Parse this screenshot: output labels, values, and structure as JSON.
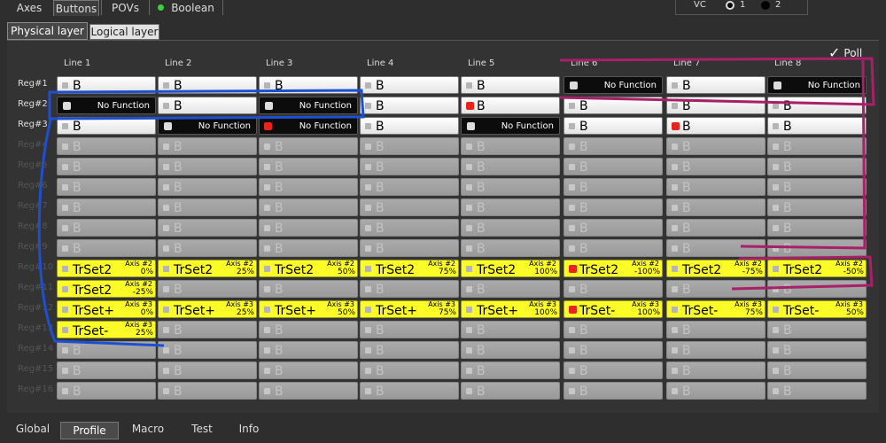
{
  "top_tabs": [
    {
      "label": "Axes",
      "active": false
    },
    {
      "label": "Buttons",
      "active": true
    },
    {
      "label": "POVs",
      "active": false
    },
    {
      "label": "Boolean",
      "active": false
    }
  ],
  "vc": {
    "label": "VC",
    "option1": "1",
    "option2": "2",
    "selected": "1"
  },
  "sub_tabs": [
    {
      "label": "Physical layer",
      "active": true
    },
    {
      "label": "Logical layer",
      "active": false
    }
  ],
  "poll": {
    "label": "Poll",
    "checked": true
  },
  "columns": [
    "Line 1",
    "Line 2",
    "Line 3",
    "Line 4",
    "Line 5",
    "Line 6",
    "Line 7",
    "Line 8"
  ],
  "rows": [
    "Reg#1",
    "Reg#2",
    "Reg#3",
    "Reg#4",
    "Reg#5",
    "Reg#6",
    "Reg#7",
    "Reg#8",
    "Reg#9",
    "Reg#10",
    "Reg#11",
    "Reg#12",
    "Reg#13",
    "Reg#14",
    "Reg#15",
    "Reg#16"
  ],
  "grid": [
    [
      {
        "t": "B",
        "s": "white"
      },
      {
        "t": "B",
        "s": "white"
      },
      {
        "t": "B",
        "s": "white"
      },
      {
        "t": "B",
        "s": "white"
      },
      {
        "t": "B",
        "s": "white"
      },
      {
        "t": "No Function",
        "s": "black"
      },
      {
        "t": "B",
        "s": "white"
      },
      {
        "t": "No Function",
        "s": "black"
      }
    ],
    [
      {
        "t": "No Function",
        "s": "black"
      },
      {
        "t": "B",
        "s": "white"
      },
      {
        "t": "No Function",
        "s": "black"
      },
      {
        "t": "B",
        "s": "white"
      },
      {
        "t": "B",
        "s": "white",
        "red": true
      },
      {
        "t": "B",
        "s": "white"
      },
      {
        "t": "B",
        "s": "white"
      },
      {
        "t": "B",
        "s": "white"
      }
    ],
    [
      {
        "t": "B",
        "s": "white"
      },
      {
        "t": "No Function",
        "s": "black"
      },
      {
        "t": "No Function",
        "s": "black",
        "red": true
      },
      {
        "t": "B",
        "s": "white"
      },
      {
        "t": "No Function",
        "s": "black"
      },
      {
        "t": "B",
        "s": "white"
      },
      {
        "t": "B",
        "s": "white",
        "red": true
      },
      {
        "t": "B",
        "s": "white"
      }
    ],
    [
      {
        "t": "B",
        "s": "gray"
      },
      {
        "t": "B",
        "s": "gray"
      },
      {
        "t": "B",
        "s": "gray"
      },
      {
        "t": "B",
        "s": "gray"
      },
      {
        "t": "B",
        "s": "gray"
      },
      {
        "t": "B",
        "s": "gray"
      },
      {
        "t": "B",
        "s": "gray"
      },
      {
        "t": "B",
        "s": "gray"
      }
    ],
    [
      {
        "t": "B",
        "s": "gray"
      },
      {
        "t": "B",
        "s": "gray"
      },
      {
        "t": "B",
        "s": "gray"
      },
      {
        "t": "B",
        "s": "gray"
      },
      {
        "t": "B",
        "s": "gray"
      },
      {
        "t": "B",
        "s": "gray"
      },
      {
        "t": "B",
        "s": "gray"
      },
      {
        "t": "B",
        "s": "gray"
      }
    ],
    [
      {
        "t": "B",
        "s": "gray"
      },
      {
        "t": "B",
        "s": "gray"
      },
      {
        "t": "B",
        "s": "gray"
      },
      {
        "t": "B",
        "s": "gray"
      },
      {
        "t": "B",
        "s": "gray"
      },
      {
        "t": "B",
        "s": "gray"
      },
      {
        "t": "B",
        "s": "gray"
      },
      {
        "t": "B",
        "s": "gray"
      }
    ],
    [
      {
        "t": "B",
        "s": "gray"
      },
      {
        "t": "B",
        "s": "gray"
      },
      {
        "t": "B",
        "s": "gray"
      },
      {
        "t": "B",
        "s": "gray"
      },
      {
        "t": "B",
        "s": "gray"
      },
      {
        "t": "B",
        "s": "gray"
      },
      {
        "t": "B",
        "s": "gray"
      },
      {
        "t": "B",
        "s": "gray"
      }
    ],
    [
      {
        "t": "B",
        "s": "gray"
      },
      {
        "t": "B",
        "s": "gray"
      },
      {
        "t": "B",
        "s": "gray"
      },
      {
        "t": "B",
        "s": "gray"
      },
      {
        "t": "B",
        "s": "gray"
      },
      {
        "t": "B",
        "s": "gray"
      },
      {
        "t": "B",
        "s": "gray"
      },
      {
        "t": "B",
        "s": "gray"
      }
    ],
    [
      {
        "t": "B",
        "s": "gray"
      },
      {
        "t": "B",
        "s": "gray"
      },
      {
        "t": "B",
        "s": "gray"
      },
      {
        "t": "B",
        "s": "gray"
      },
      {
        "t": "B",
        "s": "gray"
      },
      {
        "t": "B",
        "s": "gray"
      },
      {
        "t": "B",
        "s": "gray"
      },
      {
        "t": "B",
        "s": "gray"
      }
    ],
    [
      {
        "t": "TrSet2",
        "s": "yellow",
        "a1": "Axis #2",
        "a2": "0%"
      },
      {
        "t": "TrSet2",
        "s": "yellow",
        "a1": "Axis #2",
        "a2": "25%"
      },
      {
        "t": "TrSet2",
        "s": "yellow",
        "a1": "Axis #2",
        "a2": "50%"
      },
      {
        "t": "TrSet2",
        "s": "yellow",
        "a1": "Axis #2",
        "a2": "75%"
      },
      {
        "t": "TrSet2",
        "s": "yellow",
        "a1": "Axis #2",
        "a2": "100%"
      },
      {
        "t": "TrSet2",
        "s": "yellow",
        "red": true,
        "a1": "Axis #2",
        "a2": "-100%"
      },
      {
        "t": "TrSet2",
        "s": "yellow",
        "a1": "Axis #2",
        "a2": "-75%"
      },
      {
        "t": "TrSet2",
        "s": "yellow",
        "a1": "Axis #2",
        "a2": "-50%"
      }
    ],
    [
      {
        "t": "TrSet2",
        "s": "yellow",
        "a1": "Axis #2",
        "a2": "-25%"
      },
      {
        "t": "B",
        "s": "gray"
      },
      {
        "t": "B",
        "s": "gray"
      },
      {
        "t": "B",
        "s": "gray"
      },
      {
        "t": "B",
        "s": "gray"
      },
      {
        "t": "B",
        "s": "gray"
      },
      {
        "t": "B",
        "s": "gray"
      },
      {
        "t": "B",
        "s": "gray"
      }
    ],
    [
      {
        "t": "TrSet+",
        "s": "yellow",
        "a1": "Axis #3",
        "a2": "0%"
      },
      {
        "t": "TrSet+",
        "s": "yellow",
        "a1": "Axis #3",
        "a2": "25%"
      },
      {
        "t": "TrSet+",
        "s": "yellow",
        "a1": "Axis #3",
        "a2": "50%"
      },
      {
        "t": "TrSet+",
        "s": "yellow",
        "a1": "Axis #3",
        "a2": "75%"
      },
      {
        "t": "TrSet+",
        "s": "yellow",
        "a1": "Axis #3",
        "a2": "100%"
      },
      {
        "t": "TrSet-",
        "s": "yellow",
        "red": true,
        "a1": "Axis #3",
        "a2": "100%"
      },
      {
        "t": "TrSet-",
        "s": "yellow",
        "a1": "Axis #3",
        "a2": "75%"
      },
      {
        "t": "TrSet-",
        "s": "yellow",
        "a1": "Axis #3",
        "a2": "50%"
      }
    ],
    [
      {
        "t": "TrSet-",
        "s": "yellow",
        "a1": "Axis #3",
        "a2": "25%"
      },
      {
        "t": "B",
        "s": "gray"
      },
      {
        "t": "B",
        "s": "gray"
      },
      {
        "t": "B",
        "s": "gray"
      },
      {
        "t": "B",
        "s": "gray"
      },
      {
        "t": "B",
        "s": "gray"
      },
      {
        "t": "B",
        "s": "gray"
      },
      {
        "t": "B",
        "s": "gray"
      }
    ],
    [
      {
        "t": "B",
        "s": "gray"
      },
      {
        "t": "B",
        "s": "gray"
      },
      {
        "t": "B",
        "s": "gray"
      },
      {
        "t": "B",
        "s": "gray"
      },
      {
        "t": "B",
        "s": "gray"
      },
      {
        "t": "B",
        "s": "gray"
      },
      {
        "t": "B",
        "s": "gray"
      },
      {
        "t": "B",
        "s": "gray"
      }
    ],
    [
      {
        "t": "B",
        "s": "gray"
      },
      {
        "t": "B",
        "s": "gray"
      },
      {
        "t": "B",
        "s": "gray"
      },
      {
        "t": "B",
        "s": "gray"
      },
      {
        "t": "B",
        "s": "gray"
      },
      {
        "t": "B",
        "s": "gray"
      },
      {
        "t": "B",
        "s": "gray"
      },
      {
        "t": "B",
        "s": "gray"
      }
    ],
    [
      {
        "t": "B",
        "s": "gray"
      },
      {
        "t": "B",
        "s": "gray"
      },
      {
        "t": "B",
        "s": "gray"
      },
      {
        "t": "B",
        "s": "gray"
      },
      {
        "t": "B",
        "s": "gray"
      },
      {
        "t": "B",
        "s": "gray"
      },
      {
        "t": "B",
        "s": "gray"
      },
      {
        "t": "B",
        "s": "gray"
      }
    ]
  ],
  "bottom_tabs": [
    {
      "label": "Global",
      "active": false
    },
    {
      "label": "Profile",
      "active": true
    },
    {
      "label": "Macro",
      "active": false
    },
    {
      "label": "Test",
      "active": false
    },
    {
      "label": "Info",
      "active": false
    }
  ],
  "colors": {
    "annotation_blue": "#1f4fd1",
    "annotation_magenta": "#a8206a",
    "cell_yellow": "#fbfb28",
    "led_red": "#e8231b",
    "led_green": "#3ecf3e"
  }
}
